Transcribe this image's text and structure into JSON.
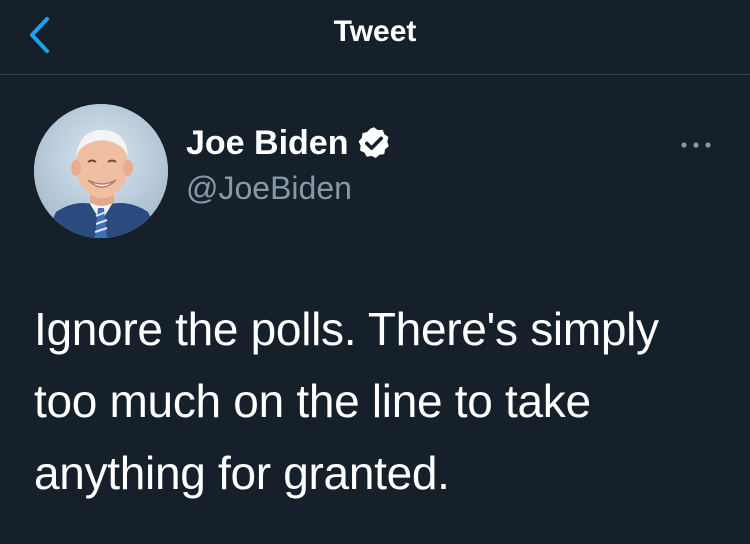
{
  "nav": {
    "title": "Tweet",
    "back_icon": "chevron-left-icon"
  },
  "tweet": {
    "author": {
      "display_name": "Joe Biden",
      "handle": "@JoeBiden",
      "verified": true
    },
    "text": "Ignore the polls. There's simply too much on the line to take anything for granted.",
    "more_icon": "more-horizontal-icon"
  },
  "colors": {
    "background": "#15202b",
    "accent": "#1da1f2",
    "text_primary": "#ffffff",
    "text_secondary": "#8899a6",
    "divider": "#38444d"
  }
}
